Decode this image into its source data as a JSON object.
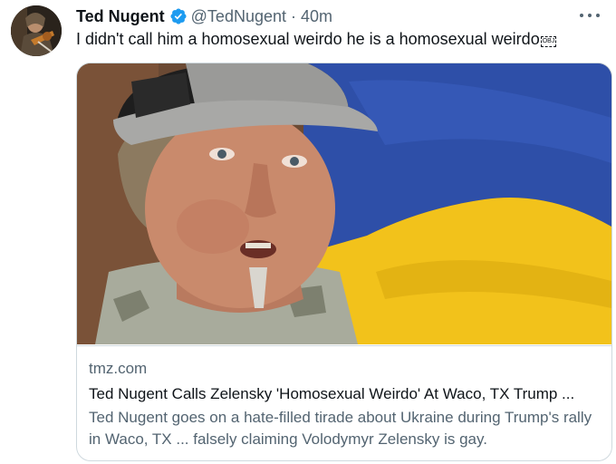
{
  "author": {
    "name": "Ted Nugent",
    "handle": "@TedNugent",
    "separator": "·",
    "time": "40m",
    "verified": true
  },
  "tweet": {
    "text": "I didn't call him a homosexual weirdo he is a homosexual weirdo",
    "trailing_glyph": "OBJ"
  },
  "card": {
    "domain": "tmz.com",
    "title": "Ted Nugent Calls Zelensky 'Homosexual Weirdo' At Waco, TX Trump ...",
    "description": "Ted Nugent goes on a hate-filled tirade about Ukraine during Trump's rally in Waco, TX ... falsely claiming Volodymyr Zelensky is gay.",
    "image_subject": "man in gray trucker cap in front of Ukrainian flag"
  },
  "icons": {
    "verified": "verified-badge-icon",
    "more": "more-options-icon"
  },
  "colors": {
    "verified_blue": "#1d9bf0",
    "secondary_text": "#536471",
    "primary_text": "#0f1419",
    "border": "#cfd9de",
    "flag_blue": "#2e4fa8",
    "flag_yellow": "#f5c518"
  }
}
